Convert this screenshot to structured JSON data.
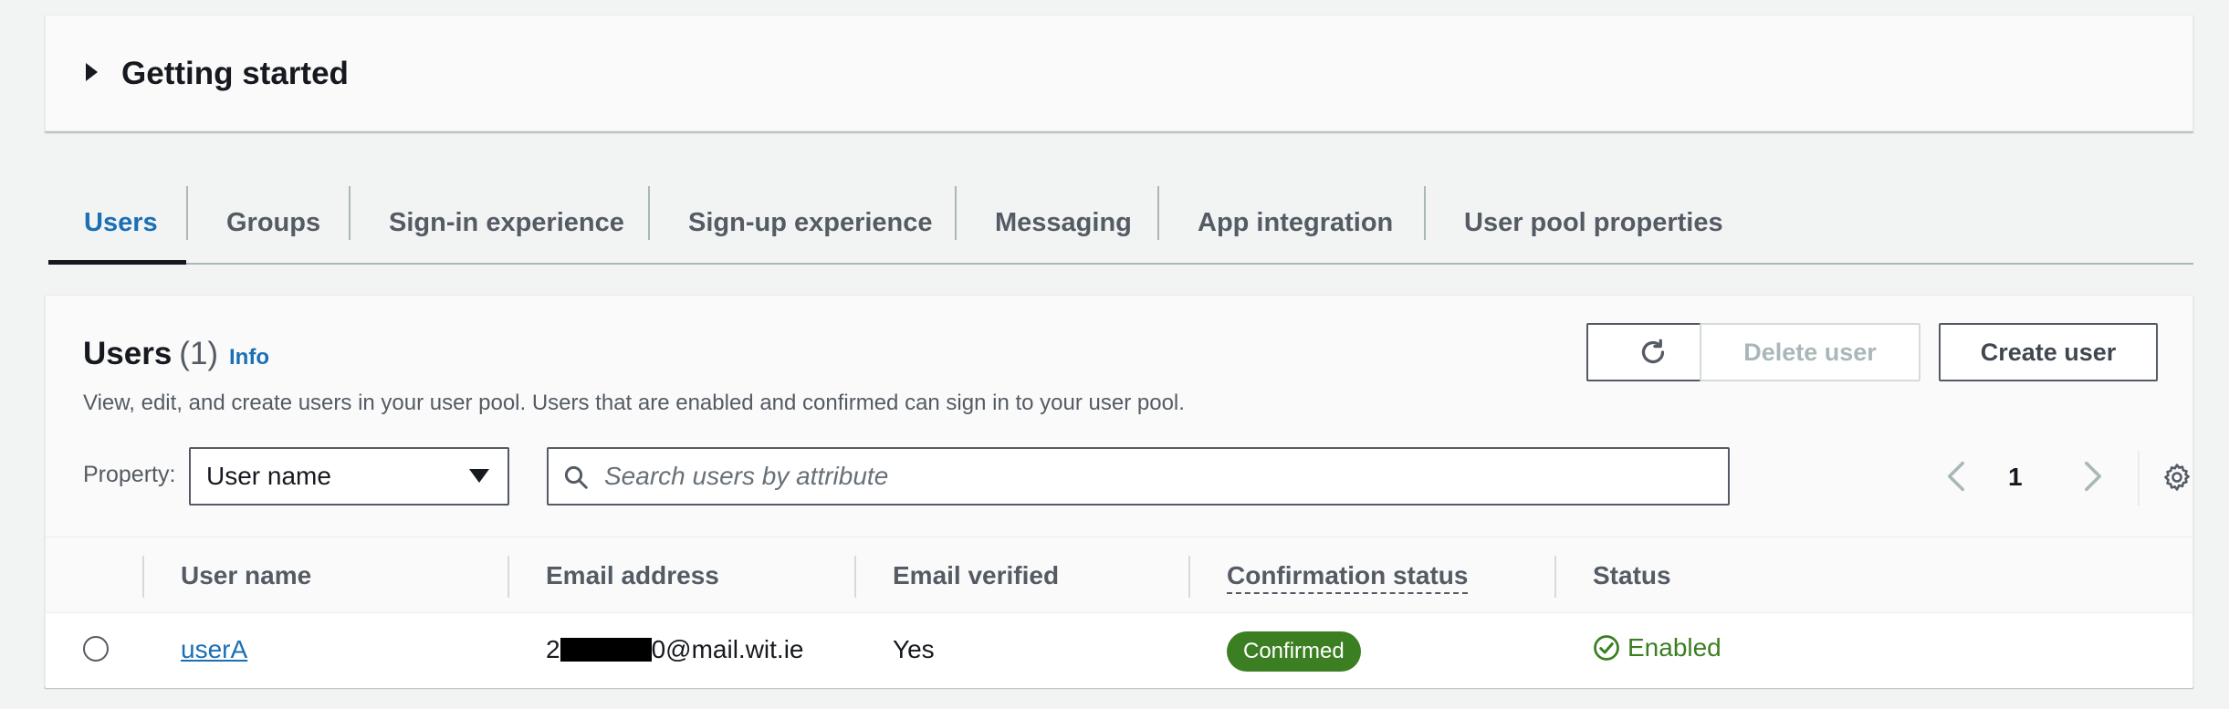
{
  "getting_started": {
    "title": "Getting started"
  },
  "tabs": [
    {
      "label": "Users",
      "active": true
    },
    {
      "label": "Groups"
    },
    {
      "label": "Sign-in experience"
    },
    {
      "label": "Sign-up experience"
    },
    {
      "label": "Messaging"
    },
    {
      "label": "App integration"
    },
    {
      "label": "User pool properties"
    }
  ],
  "users": {
    "title": "Users",
    "count": "(1)",
    "info_link": "Info",
    "description": "View, edit, and create users in your user pool. Users that are enabled and confirmed can sign in to your user pool.",
    "delete_label": "Delete user",
    "create_label": "Create user",
    "property_label": "Property:",
    "property_value": "User name",
    "search_placeholder": "Search users by attribute",
    "page": "1"
  },
  "table": {
    "columns": [
      "User name",
      "Email address",
      "Email verified",
      "Confirmation status",
      "Status"
    ],
    "rows": [
      {
        "user_name": "userA",
        "email_prefix": "2",
        "email_suffix": "0@mail.wit.ie",
        "email_verified": "Yes",
        "confirmation_status": "Confirmed",
        "status": "Enabled"
      }
    ]
  },
  "colors": {
    "link": "#1a6fb5",
    "badge_green": "#3b7f22",
    "status_green": "#3b7f22"
  },
  "icons": [
    "caret-right-icon",
    "refresh-icon",
    "search-icon",
    "chevron-left-icon",
    "chevron-right-icon",
    "gear-icon",
    "dropdown-caret-icon",
    "status-check-icon"
  ]
}
